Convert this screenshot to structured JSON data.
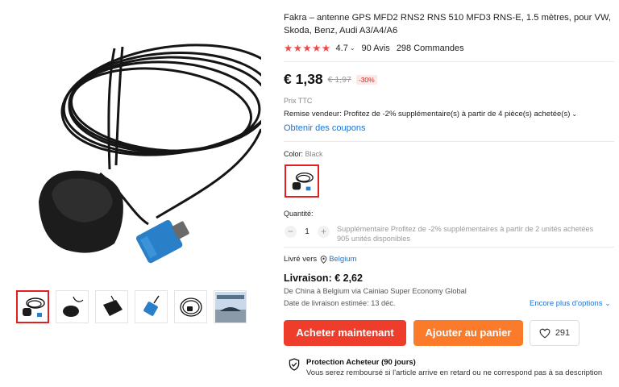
{
  "product": {
    "title": "Fakra – antenne GPS MFD2 RNS2 RNS 510 MFD3 RNS-E, 1.5 mètres, pour VW, Skoda, Benz, Audi A3/A4/A6",
    "stars": "★★★★★",
    "rating": "4.7",
    "reviews": "90 Avis",
    "orders": "298 Commandes"
  },
  "price": {
    "current": "€ 1,38",
    "original": "€ 1,97",
    "discount": "-30%",
    "tax_note": "Prix TTC",
    "seller_discount": "Remise vendeur: Profitez de -2% supplémentaire(s) à partir de 4 pièce(s) achetée(s)",
    "coupons_link": "Obtenir des coupons"
  },
  "color": {
    "label": "Color:",
    "value": "Black"
  },
  "quantity": {
    "label": "Quantité:",
    "minus": "−",
    "value": "1",
    "plus": "+",
    "note_line1": "Supplémentaire Profitez de -2% supplémentaires à partir de 2 unités achetées",
    "note_line2": "905 unités disponibles"
  },
  "shipping": {
    "deliver_to_label": "Livré vers",
    "country": "Belgium",
    "cost": "Livraison: € 2,62",
    "route": "De China à Belgium via Cainiao Super Economy Global",
    "estimate": "Date de livraison estimée: 13 déc.",
    "more_options": "Encore plus d'options"
  },
  "actions": {
    "buy_now": "Acheter maintenant",
    "add_to_cart": "Ajouter au panier",
    "wishlist_count": "291"
  },
  "protection": {
    "title": "Protection Acheteur (90 jours)",
    "description": "Vous serez remboursé si l'article arrive en retard ou ne correspond pas à sa description"
  },
  "colors": {
    "accent": "#ef3d2c",
    "cart": "#fb7b2b",
    "link": "#1a73d9",
    "stars": "#f04848",
    "connector": "#2a7fc9"
  }
}
